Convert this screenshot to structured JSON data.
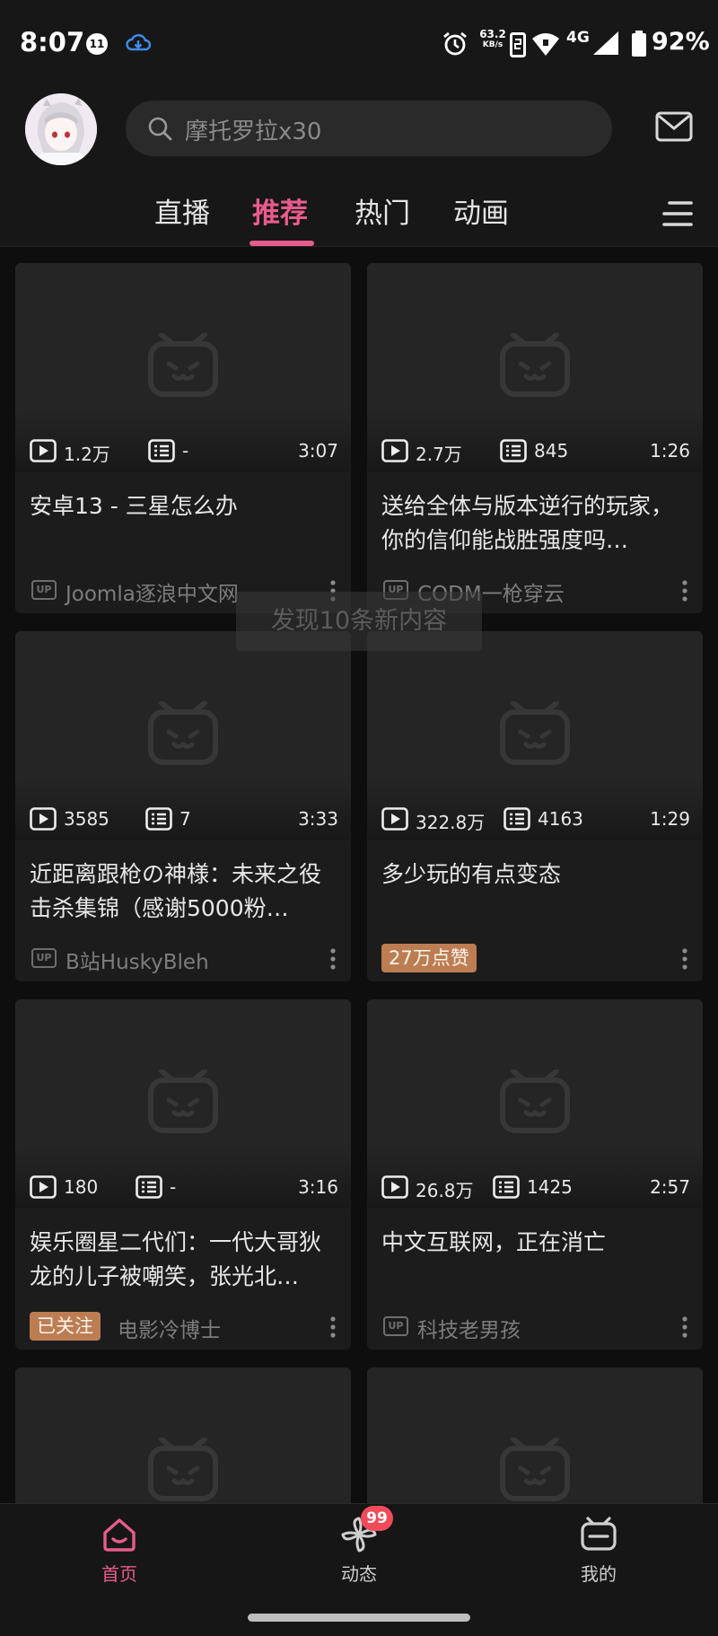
{
  "status_bar": {
    "time": "8:07",
    "notification_count": "11",
    "rate_value": "63.2",
    "rate_unit": "KB/s",
    "network": "4G",
    "battery": "92%"
  },
  "header": {
    "search_placeholder": "摩托罗拉x30"
  },
  "tabs": [
    {
      "label": "直播",
      "active": false
    },
    {
      "label": "推荐",
      "active": true
    },
    {
      "label": "热门",
      "active": false
    },
    {
      "label": "动画",
      "active": false
    }
  ],
  "overlay_toast": "发现10条新内容",
  "cards": [
    {
      "plays": "1.2万",
      "danmaku": "-",
      "duration": "3:07",
      "title": "安卓13 - 三星怎么办",
      "up_label": "UP",
      "up_name": "Joomla逐浪中文网"
    },
    {
      "plays": "2.7万",
      "danmaku": "845",
      "duration": "1:26",
      "title": "送给全体与版本逆行的玩家，你的信仰能战胜强度吗…",
      "up_label": "UP",
      "up_name": "CODM一枪穿云"
    },
    {
      "plays": "3585",
      "danmaku": "7",
      "duration": "3:33",
      "title": "近距离跟枪の神様：未来之役击杀集锦（感谢5000粉…",
      "up_label": "UP",
      "up_name": "B站HuskyBleh"
    },
    {
      "plays": "322.8万",
      "danmaku": "4163",
      "duration": "1:29",
      "title": "多少玩的有点变态",
      "tag": "27万点赞"
    },
    {
      "plays": "180",
      "danmaku": "-",
      "duration": "3:16",
      "title": "娱乐圈星二代们：一代大哥狄龙的儿子被嘲笑，张光北…",
      "tag": "已关注",
      "up_name": "电影冷博士"
    },
    {
      "plays": "26.8万",
      "danmaku": "1425",
      "duration": "2:57",
      "title": "中文互联网，正在消亡",
      "up_label": "UP",
      "up_name": "科技老男孩"
    }
  ],
  "bottom_nav": {
    "items": [
      {
        "label": "首页",
        "icon": "home-icon",
        "active": true
      },
      {
        "label": "动态",
        "icon": "pinwheel-icon",
        "active": false,
        "badge": "99"
      },
      {
        "label": "我的",
        "icon": "tv-face-icon",
        "active": false
      }
    ]
  },
  "colors": {
    "accent": "#e85c8d",
    "background": "#0e0e0e",
    "card": "#1c1c1c",
    "tag": "#bc7d52",
    "badge": "#f04b5a"
  }
}
